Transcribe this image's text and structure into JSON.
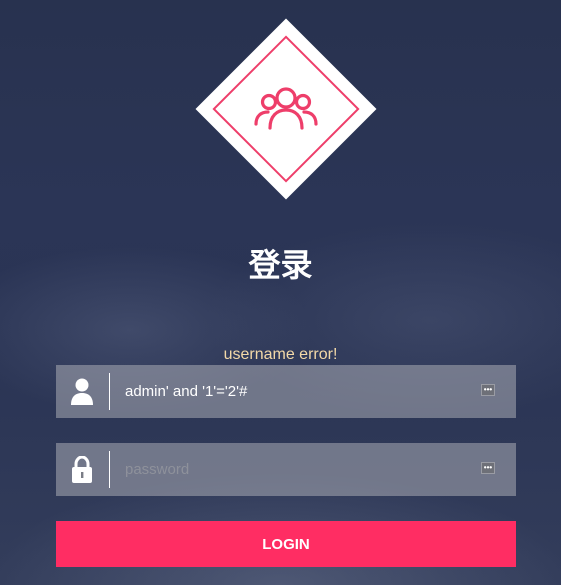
{
  "page": {
    "title": "登录"
  },
  "logo": {
    "icon": "users-icon",
    "accent_color": "#ee3e6a"
  },
  "error": {
    "message": "username error!",
    "color": "#f3d9a8"
  },
  "form": {
    "username": {
      "icon": "user-icon",
      "value": "admin' and '1'='2'#",
      "placeholder": "",
      "action_icon": "key-icon"
    },
    "password": {
      "icon": "lock-icon",
      "value": "",
      "placeholder": "password",
      "action_icon": "key-icon"
    },
    "submit_label": "LOGIN",
    "submit_color": "#ff2d63"
  }
}
